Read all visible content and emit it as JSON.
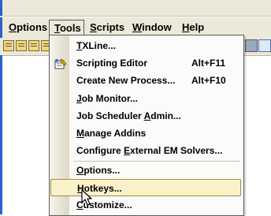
{
  "menubar": {
    "items": [
      {
        "pre": "",
        "key": "O",
        "post": "ptions"
      },
      {
        "pre": "",
        "key": "T",
        "post": "ools"
      },
      {
        "pre": "",
        "key": "S",
        "post": "cripts"
      },
      {
        "pre": "",
        "key": "W",
        "post": "indow"
      },
      {
        "pre": "",
        "key": "H",
        "post": "elp"
      }
    ],
    "active": "Tools"
  },
  "tools_menu": {
    "items": [
      {
        "pre": "",
        "key": "T",
        "post": "XLine...",
        "shortcut": ""
      },
      {
        "pre": "Scripting Editor",
        "key": "",
        "post": "",
        "shortcut": "Alt+F11"
      },
      {
        "pre": "Create New Process...",
        "key": "",
        "post": "",
        "shortcut": "Alt+F10"
      },
      {
        "pre": "",
        "key": "J",
        "post": "ob Monitor...",
        "shortcut": ""
      },
      {
        "pre": "Job Scheduler ",
        "key": "A",
        "post": "dmin...",
        "shortcut": ""
      },
      {
        "pre": "",
        "key": "M",
        "post": "anage Addins",
        "shortcut": ""
      },
      {
        "pre": "Configure ",
        "key": "E",
        "post": "xternal EM Solvers...",
        "shortcut": ""
      },
      {
        "pre": "",
        "key": "O",
        "post": "ptions...",
        "shortcut": ""
      },
      {
        "pre": "",
        "key": "H",
        "post": "otkeys...",
        "shortcut": ""
      },
      {
        "pre": "",
        "key": "C",
        "post": "ustomize...",
        "shortcut": ""
      }
    ],
    "highlighted": "Hotkeys..."
  },
  "colors": {
    "menu_bg": "#ece9d8",
    "highlight_bg": "#fbf1c9",
    "highlight_border": "#9d8a44",
    "window_edge": "#2a63c9"
  },
  "icons": {
    "scripting_editor": "script-editor-icon",
    "cursor": "mouse-pointer-icon"
  }
}
